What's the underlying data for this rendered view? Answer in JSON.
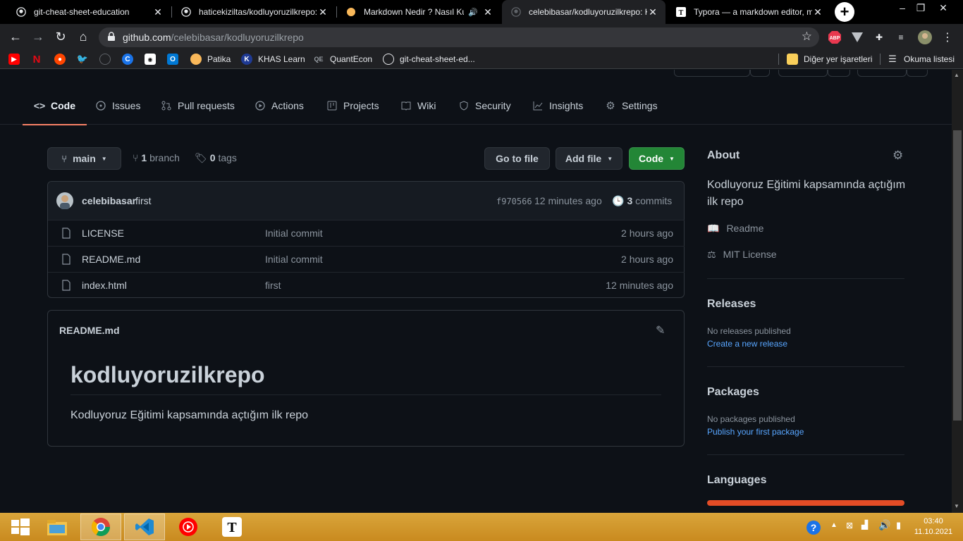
{
  "browser": {
    "tabs": [
      {
        "title": "git-cheat-sheet-education",
        "icon": "github-icon",
        "active": false
      },
      {
        "title": "haticekiziltas/kodluyoruzilkrepo:",
        "icon": "github-icon",
        "active": false
      },
      {
        "title": "Markdown Nedir ? Nasıl Kul",
        "icon": "circle-icon",
        "active": false
      },
      {
        "title": "celebibasar/kodluyoruzilkrepo: K",
        "icon": "github-icon",
        "active": true
      },
      {
        "title": "Typora — a markdown editor, m",
        "icon": "typora-icon",
        "active": false
      }
    ],
    "url_host": "github.com",
    "url_path": "/celebibasar/kodluyoruzilkrepo",
    "bookmarks": [
      {
        "label": "",
        "icon": "youtube-icon"
      },
      {
        "label": "",
        "icon": "netflix-icon"
      },
      {
        "label": "",
        "icon": "reddit-icon"
      },
      {
        "label": "",
        "icon": "twitter-icon"
      },
      {
        "label": "",
        "icon": "github-icon"
      },
      {
        "label": "",
        "icon": "c-icon"
      },
      {
        "label": "",
        "icon": "news-icon"
      },
      {
        "label": "",
        "icon": "outlook-icon"
      },
      {
        "label": "Patika",
        "icon": "patika-icon"
      },
      {
        "label": "KHAS Learn",
        "icon": "khas-icon"
      },
      {
        "label": "QuantEcon",
        "icon": "quantecon-icon"
      },
      {
        "label": "git-cheat-sheet-ed...",
        "icon": "github-icon"
      }
    ],
    "other_bookmarks": "Diğer yer işaretleri",
    "reading_list": "Okuma listesi",
    "abp": "ABP"
  },
  "repo": {
    "nav": [
      {
        "label": "Code",
        "icon": "code-icon",
        "selected": true
      },
      {
        "label": "Issues",
        "icon": "issues-icon",
        "selected": false
      },
      {
        "label": "Pull requests",
        "icon": "pull-request-icon",
        "selected": false
      },
      {
        "label": "Actions",
        "icon": "actions-icon",
        "selected": false
      },
      {
        "label": "Projects",
        "icon": "projects-icon",
        "selected": false
      },
      {
        "label": "Wiki",
        "icon": "wiki-icon",
        "selected": false
      },
      {
        "label": "Security",
        "icon": "shield-icon",
        "selected": false
      },
      {
        "label": "Insights",
        "icon": "graph-icon",
        "selected": false
      },
      {
        "label": "Settings",
        "icon": "gear-icon",
        "selected": false
      }
    ],
    "branch": "main",
    "branch_count": "1",
    "branch_word": "branch",
    "tag_count": "0",
    "tag_word": "tags",
    "go_to_file": "Go to file",
    "add_file": "Add file",
    "code_button": "Code",
    "commit": {
      "author": "celebibasar",
      "message": "first",
      "sha": "f970566",
      "age": "12 minutes ago",
      "count": "3",
      "count_word": "commits"
    },
    "files": [
      {
        "name": "LICENSE",
        "message": "Initial commit",
        "age": "2 hours ago"
      },
      {
        "name": "README.md",
        "message": "Initial commit",
        "age": "2 hours ago"
      },
      {
        "name": "index.html",
        "message": "first",
        "age": "12 minutes ago"
      }
    ],
    "readme": {
      "filename": "README.md",
      "heading": "kodluyoruzilkrepo",
      "body": "Kodluyoruz Eğitimi kapsamında açtığım ilk repo"
    }
  },
  "sidebar": {
    "about_title": "About",
    "about_desc": "Kodluyoruz Eğitimi kapsamında açtığım ilk repo",
    "readme_link": "Readme",
    "license_link": "MIT License",
    "releases_title": "Releases",
    "releases_none": "No releases published",
    "releases_create": "Create a new release",
    "packages_title": "Packages",
    "packages_none": "No packages published",
    "packages_publish": "Publish your first package",
    "languages_title": "Languages",
    "language_color": "#e34c26"
  },
  "taskbar": {
    "time": "03:40",
    "date": "11.10.2021"
  }
}
